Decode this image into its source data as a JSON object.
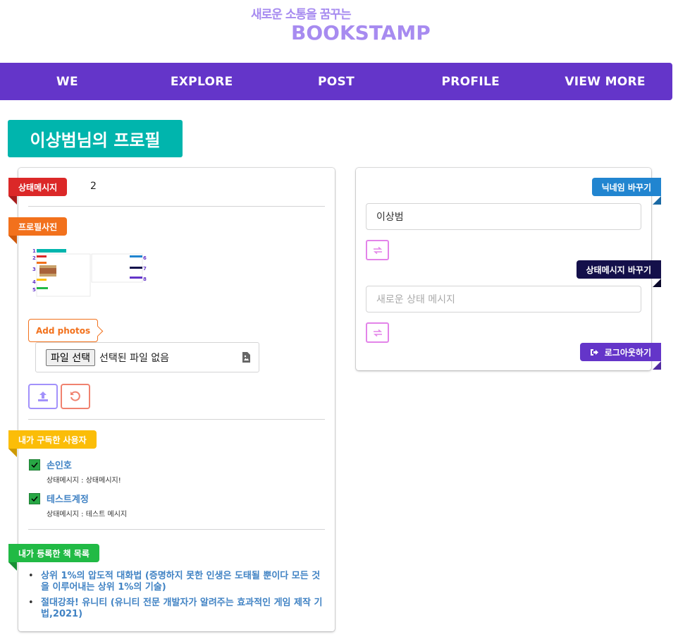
{
  "header": {
    "tagline": "새로운 소통을 꿈꾸는",
    "brand": "BOOKSTAMP"
  },
  "nav": {
    "items": [
      "WE",
      "EXPLORE",
      "POST",
      "PROFILE",
      "VIEW MORE"
    ]
  },
  "page_title": "이상범님의 프로필",
  "left_card": {
    "status_label": "상태메시지",
    "status_value": "2",
    "photo_label": "프로필사진",
    "add_photos_label": "Add photos",
    "file_button_label": "파일 선택",
    "file_status": "선택된 파일 없음",
    "subscribed_label": "내가 구독한 사용자",
    "users": [
      {
        "name": "손인호",
        "status": "상태메시지 : 상태메시지!"
      },
      {
        "name": "테스트계정",
        "status": "상태메시지 : 테스트 메시지"
      }
    ],
    "books_label": "내가 등록한 책 목록",
    "books": [
      "상위 1%의 압도적 대화법 (증명하지 못한 인생은 도태될 뿐이다 모든 것을 이루어내는 상위 1%의 기술)",
      "절대강좌! 유니티 (유니티 전문 개발자가 알려주는 효과적인 게임 제작 기법,2021)"
    ]
  },
  "right_card": {
    "nickname_label": "닉네임 바꾸기",
    "nickname_value": "이상범",
    "status_change_label": "상태메시지 바꾸기",
    "status_placeholder": "새로운 상태 메시지",
    "logout_label": "로그아웃하기"
  },
  "colors": {
    "brand": "#a78bf0",
    "nav": "#6435c9",
    "title": "#00b5ad",
    "red": "#db2828",
    "orange": "#f2711c",
    "yellow": "#fbbd08",
    "green": "#21ba45",
    "blue": "#2185d0",
    "link": "#4183c4"
  },
  "icons": {
    "upload": "upload-icon",
    "reset": "undo-icon",
    "swap": "exchange-icon",
    "logout": "sign-out-icon",
    "file": "file-image-icon"
  }
}
